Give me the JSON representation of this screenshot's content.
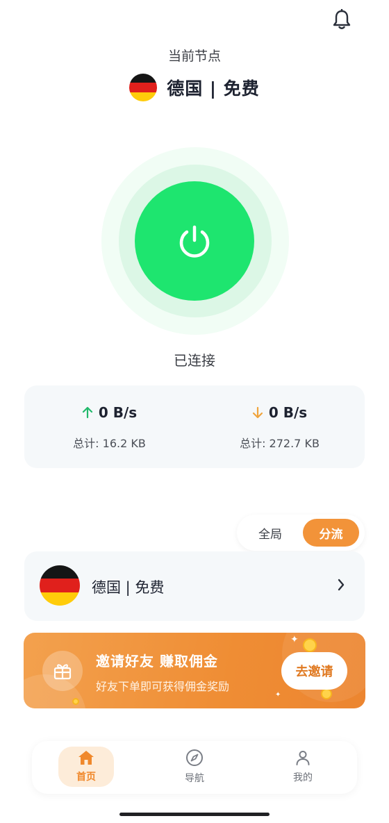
{
  "header": {
    "bell_icon": "bell-icon"
  },
  "node": {
    "caption": "当前节点",
    "title": "德国 | 免费",
    "flag_icon": "germany-flag-icon"
  },
  "connection": {
    "status": "已连接",
    "button_color": "#1ee56f"
  },
  "stats": {
    "upload": {
      "speed": "0 B/s",
      "total": "总计: 16.2 KB",
      "arrow_color": "#21b96b"
    },
    "download": {
      "speed": "0 B/s",
      "total": "总计: 272.7 KB",
      "arrow_color": "#f0a43c"
    }
  },
  "mode": {
    "global_label": "全局",
    "split_label": "分流",
    "selected": "split"
  },
  "node_card": {
    "name": "德国 | 免费"
  },
  "invite": {
    "title": "邀请好友 赚取佣金",
    "subtitle": "好友下单即可获得佣金奖励",
    "button": "去邀请"
  },
  "tabs": [
    {
      "label": "首页",
      "icon": "home-icon",
      "active": true
    },
    {
      "label": "导航",
      "icon": "compass-icon",
      "active": false
    },
    {
      "label": "我的",
      "icon": "user-icon",
      "active": false
    }
  ],
  "colors": {
    "accent": "#f29339",
    "green": "#1ee56f"
  }
}
